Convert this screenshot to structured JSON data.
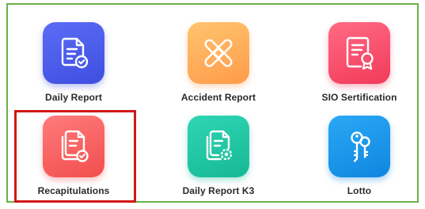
{
  "menu": {
    "items": [
      {
        "label": "Daily Report",
        "icon": "document-check-icon",
        "color_top": "#5b6cf6",
        "color_bottom": "#3e4fe0"
      },
      {
        "label": "Accident Report",
        "icon": "bandage-icon",
        "color_top": "#ffc46f",
        "color_bottom": "#ff9b4a"
      },
      {
        "label": "SIO Sertification",
        "icon": "certificate-icon",
        "color_top": "#ff6b84",
        "color_bottom": "#f23a5a"
      },
      {
        "label": "Recapitulations",
        "icon": "documents-check-icon",
        "color_top": "#ff7b7b",
        "color_bottom": "#f24e4e"
      },
      {
        "label": "Daily Report K3",
        "icon": "documents-gear-icon",
        "color_top": "#2fd6b4",
        "color_bottom": "#17b894"
      },
      {
        "label": "Lotto",
        "icon": "keys-icon",
        "color_top": "#2aa8f5",
        "color_bottom": "#0f86e0"
      }
    ],
    "selected_label": "Recapitulations"
  },
  "colors": {
    "frame_border": "#6bb24a",
    "highlight_border": "#d01818"
  }
}
